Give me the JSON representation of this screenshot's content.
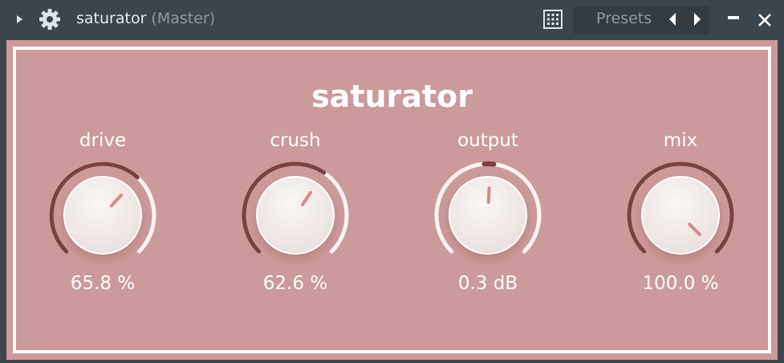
{
  "window": {
    "title": "saturator",
    "subtitle": "(Master)",
    "presets_label": "Presets",
    "icons": [
      "expand-arrow-icon",
      "gear-icon",
      "grid-icon",
      "chevron-left-icon",
      "chevron-right-icon",
      "minimize-icon",
      "close-icon"
    ]
  },
  "plugin": {
    "title": "saturator",
    "knobs": [
      {
        "id": "drive",
        "label": "drive",
        "value_text": "65.8 %",
        "value": 0.658,
        "type": "unipolar"
      },
      {
        "id": "crush",
        "label": "crush",
        "value_text": "62.6 %",
        "value": 0.626,
        "type": "unipolar"
      },
      {
        "id": "output",
        "label": "output",
        "value_text": "0.3 dB",
        "value": 0.51,
        "type": "bipolar"
      },
      {
        "id": "mix",
        "label": "mix",
        "value_text": "100.0 %",
        "value": 1.0,
        "type": "unipolar"
      }
    ]
  },
  "colors": {
    "titlebar_bg": "#3c454c",
    "panel_bg": "#cc9a9a",
    "arc_active": "#7b4040",
    "arc_inactive": "#fbf4f2",
    "indicator": "#d28c8c",
    "knob_face": "#f3ecea"
  }
}
